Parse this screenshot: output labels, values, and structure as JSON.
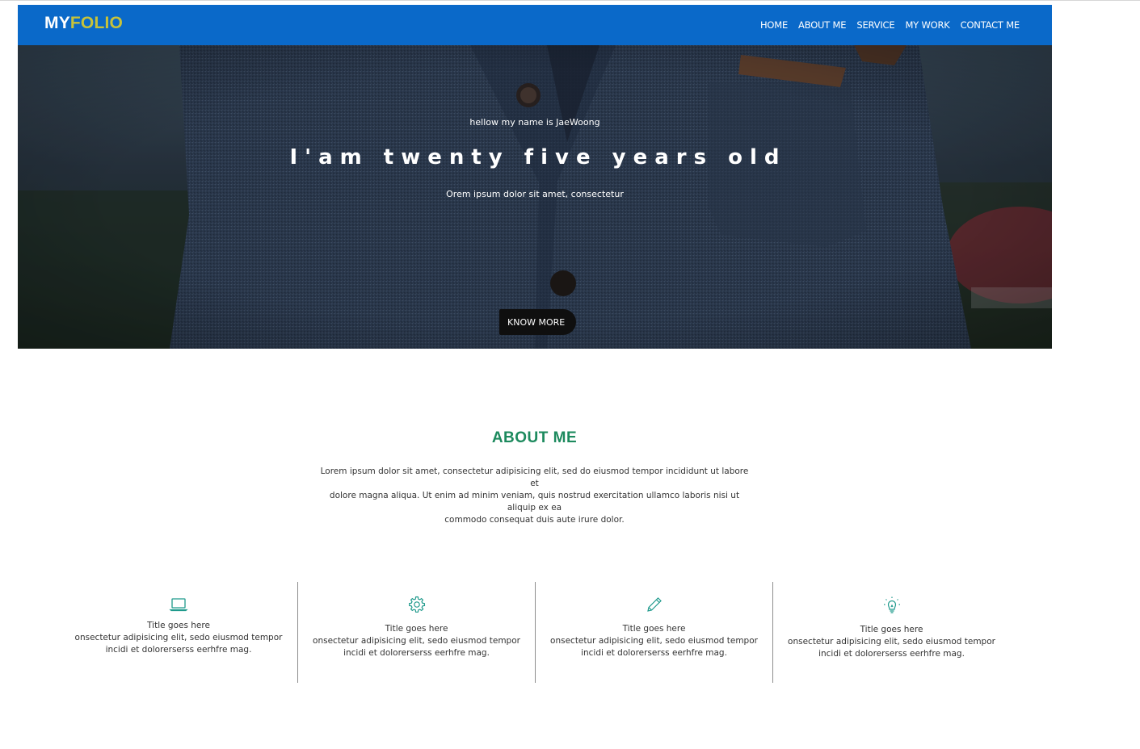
{
  "brand": {
    "logo_part1": "MY",
    "logo_part2": "FOLIO",
    "logo_color1": "#ffffff",
    "logo_color2": "#c7c23a",
    "nav_color": "#0a69c9"
  },
  "nav": [
    {
      "label": "HOME"
    },
    {
      "label": "ABOUT ME"
    },
    {
      "label": "SERVICE"
    },
    {
      "label": "MY WORK"
    },
    {
      "label": "CONTACT ME"
    }
  ],
  "hero": {
    "tagline": "hellow my name is JaeWoong",
    "title": "I'am twenty five years old",
    "subtitle": "Orem ipsum dolor sit amet, consectetur",
    "button": "KNOW MORE"
  },
  "about": {
    "title": "ABOUT ME",
    "title_color": "#1d8a5e",
    "text_line1": "Lorem ipsum dolor sit amet, consectetur adipisicing elit, sed do eiusmod tempor incididunt ut labore et",
    "text_line2": "dolore magna aliqua. Ut enim ad minim veniam, quis nostrud exercitation ullamco laboris nisi ut aliquip ex ea",
    "text_line3": "commodo consequat duis aute irure dolor."
  },
  "services": [
    {
      "icon": "laptop-icon",
      "title": "Title goes here",
      "desc1": "onsectetur adipisicing elit, sedo eiusmod tempor",
      "desc2": "incidi et dolorerserss eerhfre mag."
    },
    {
      "icon": "gear-icon",
      "title": "Title goes here",
      "desc1": "onsectetur adipisicing elit, sedo eiusmod tempor",
      "desc2": "incidi et dolorerserss eerhfre mag."
    },
    {
      "icon": "pencil-icon",
      "title": "Title goes here",
      "desc1": "onsectetur adipisicing elit, sedo eiusmod tempor",
      "desc2": "incidi et dolorerserss eerhfre mag."
    },
    {
      "icon": "lightbulb-icon",
      "title": "Title goes here",
      "desc1": "onsectetur adipisicing elit, sedo eiusmod tempor",
      "desc2": "incidi et dolorerserss eerhfre mag."
    }
  ],
  "icon_color": "#1f9a8c"
}
